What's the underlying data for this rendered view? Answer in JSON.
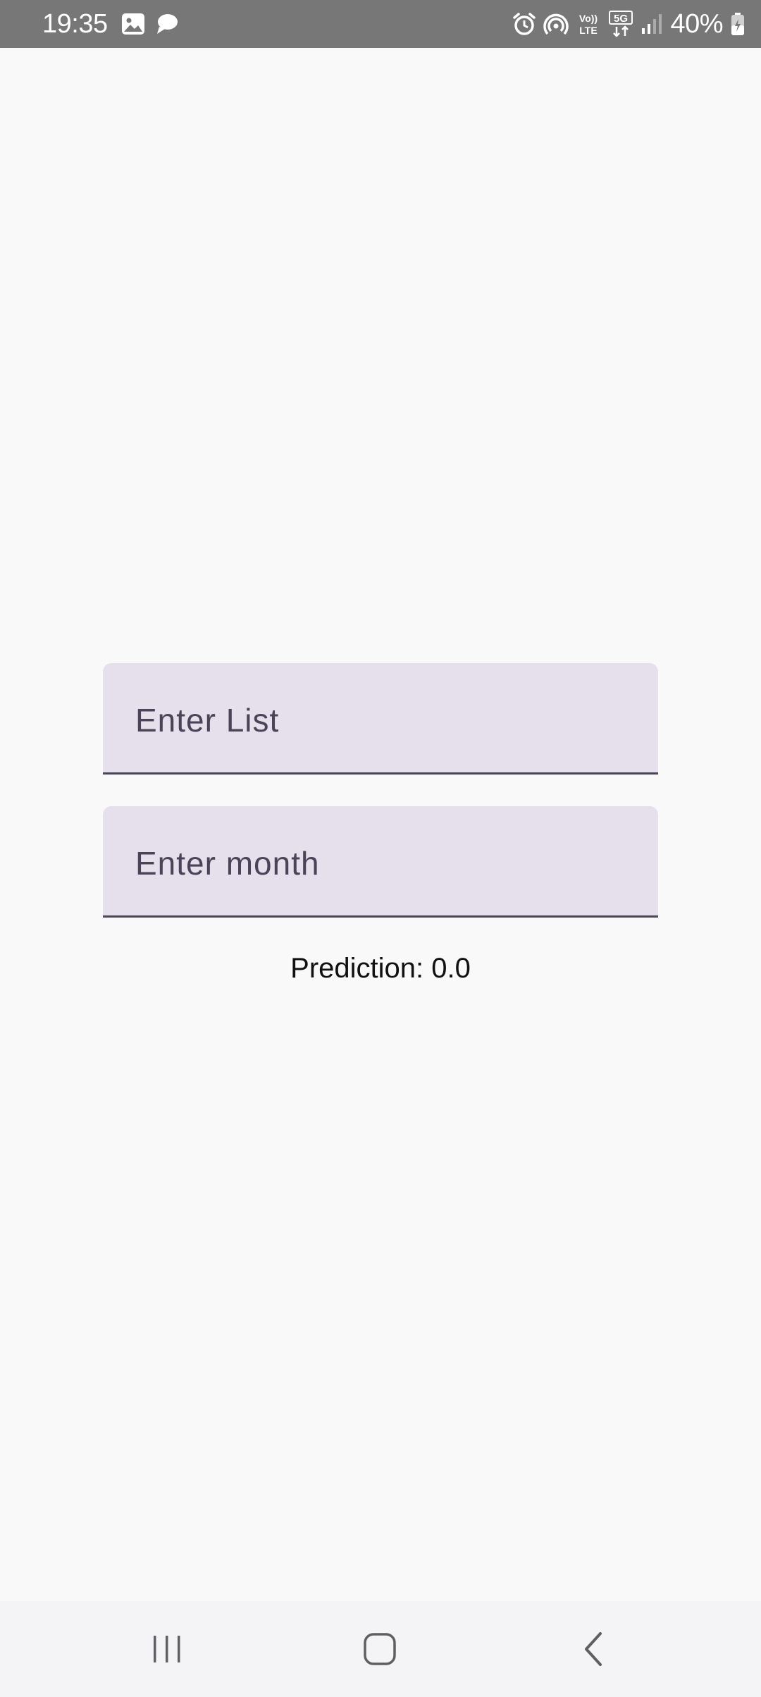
{
  "status_bar": {
    "time": "19:35",
    "left_icons": [
      "gallery-icon",
      "chat-bubble-icon"
    ],
    "right_icons": [
      "alarm-icon",
      "hotspot-icon",
      "volte-icon",
      "5g-icon",
      "signal-icon",
      "battery-charging-icon"
    ],
    "volte_line1": "Vo))",
    "volte_line2": "LTE",
    "network_label": "5G",
    "battery_percent": "40%"
  },
  "form": {
    "list_field": {
      "placeholder": "Enter List",
      "value": ""
    },
    "month_field": {
      "placeholder": "Enter month",
      "value": ""
    },
    "prediction_text": "Prediction: 0.0"
  },
  "nav_bar": {
    "icons": [
      "recents-icon",
      "home-icon",
      "back-icon"
    ]
  },
  "colors": {
    "status_bar": "#777777",
    "background": "#f9f9f9",
    "field_fill": "#e6dfec",
    "field_underline": "#4a4458",
    "placeholder_text": "#4b4458",
    "nav_bar": "#f4f4f6"
  }
}
